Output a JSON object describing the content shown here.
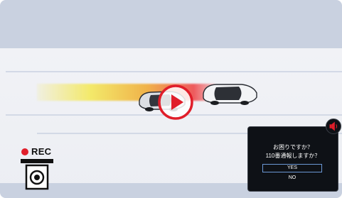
{
  "recording": {
    "label": "REC",
    "dot_color": "#e01e2a"
  },
  "dialog": {
    "question_line1": "お困りですか？",
    "question_line2": "110番通報しますか？",
    "yes_label": "YES",
    "no_label": "NO"
  },
  "icons": {
    "play": "play-button-icon",
    "camera": "camera-icon",
    "speaker": "speaker-icon"
  },
  "colors": {
    "accent_red": "#e01e2a",
    "sky": "#c9d1e0",
    "dialog_bg": "#0e1116",
    "yes_border": "#6b98d6"
  }
}
